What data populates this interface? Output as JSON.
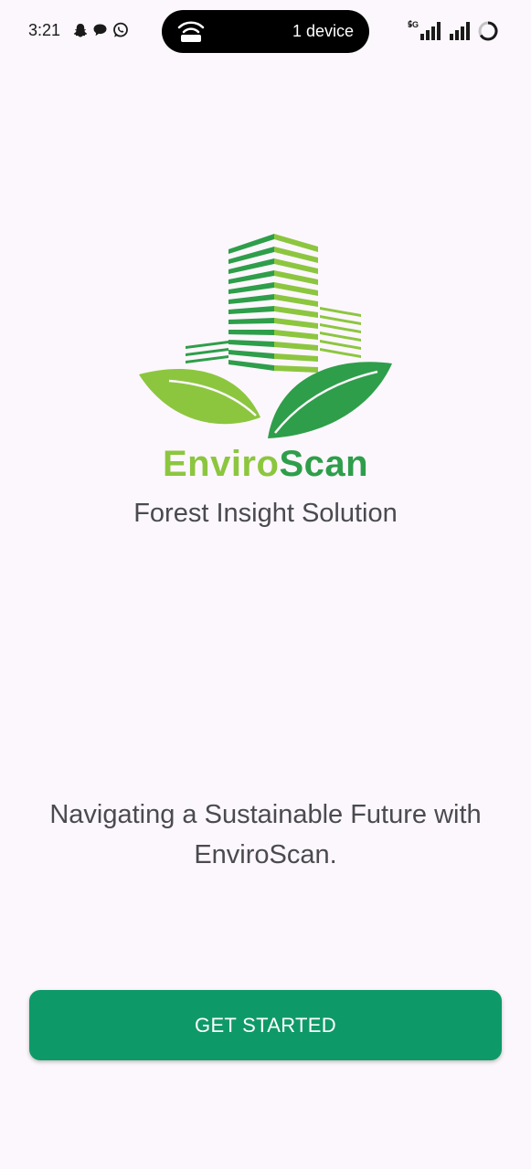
{
  "status_bar": {
    "time": "3:21",
    "hotspot_devices": "1 device",
    "network_tag": "5G",
    "notification_icons": [
      "snapchat-icon",
      "chat-bubble-icon",
      "whatsapp-icon"
    ]
  },
  "brand": {
    "name_part1": "Enviro",
    "name_part2": "Scan",
    "subtitle": "Forest Insight Solution",
    "colors": {
      "light_green": "#8cc63f",
      "dark_green": "#2e9e4a"
    }
  },
  "tagline": "Navigating a Sustainable Future with EnviroScan.",
  "cta": {
    "label": "GET STARTED",
    "color": "#0e9a68"
  }
}
